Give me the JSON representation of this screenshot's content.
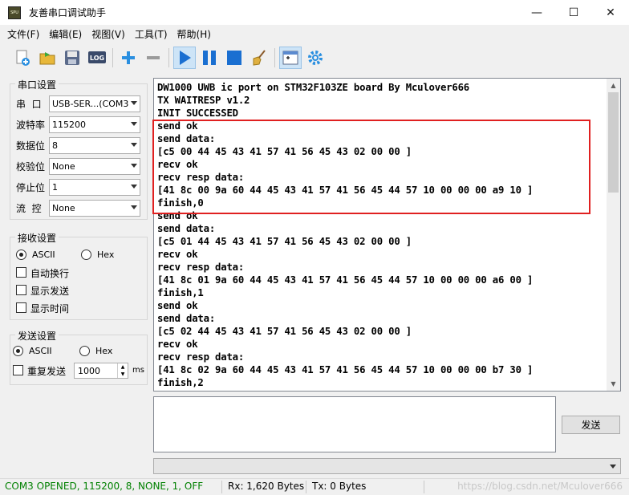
{
  "window": {
    "icon_text": "SPU",
    "title": "友善串口调试助手",
    "minimize": "—",
    "maximize": "☐",
    "close": "✕"
  },
  "menu": [
    "文件(F)",
    "编辑(E)",
    "视图(V)",
    "工具(T)",
    "帮助(H)"
  ],
  "toolbar": {
    "log_label": "LOG"
  },
  "serial_settings": {
    "title": "串口设置",
    "port_label": "串  口",
    "port_value": "USB-SER...(COM3",
    "baud_label": "波特率",
    "baud_value": "115200",
    "databits_label": "数据位",
    "databits_value": "8",
    "parity_label": "校验位",
    "parity_value": "None",
    "stopbits_label": "停止位",
    "stopbits_value": "1",
    "flow_label": "流  控",
    "flow_value": "None"
  },
  "recv_settings": {
    "title": "接收设置",
    "ascii": "ASCII",
    "hex": "Hex",
    "auto_newline": "自动换行",
    "show_send": "显示发送",
    "show_time": "显示时间"
  },
  "send_settings": {
    "title": "发送设置",
    "ascii": "ASCII",
    "hex": "Hex",
    "repeat": "重复发送",
    "interval": "1000",
    "unit": "ms"
  },
  "receive_lines": [
    "DW1000 UWB ic port on STM32F103ZE board By Mculover666",
    "TX WAITRESP v1.2",
    "INIT SUCCESSED",
    "send ok",
    "send data:",
    "[c5 00 44 45 43 41 57 41 56 45 43 02 00 00 ]",
    "recv ok",
    "recv resp data:",
    "[41 8c 00 9a 60 44 45 43 41 57 41 56 45 44 57 10 00 00 00 a9 10 ]",
    "finish,0",
    "send ok",
    "send data:",
    "[c5 01 44 45 43 41 57 41 56 45 43 02 00 00 ]",
    "recv ok",
    "recv resp data:",
    "[41 8c 01 9a 60 44 45 43 41 57 41 56 45 44 57 10 00 00 00 a6 00 ]",
    "finish,1",
    "send ok",
    "send data:",
    "[c5 02 44 45 43 41 57 41 56 45 43 02 00 00 ]",
    "recv ok",
    "recv resp data:",
    "[41 8c 02 9a 60 44 45 43 41 57 41 56 45 44 57 10 00 00 00 b7 30 ]",
    "finish,2"
  ],
  "send_button": "发送",
  "status": {
    "port_state": "COM3 OPENED, 115200, 8, NONE, 1, OFF",
    "rx": "Rx: 1,620 Bytes",
    "tx": "Tx: 0 Bytes",
    "watermark": "https://blog.csdn.net/Mculover666"
  },
  "colors": {
    "status_ok": "#008000",
    "highlight": "#e02020",
    "toolbar_blue": "#1a6fd1"
  }
}
